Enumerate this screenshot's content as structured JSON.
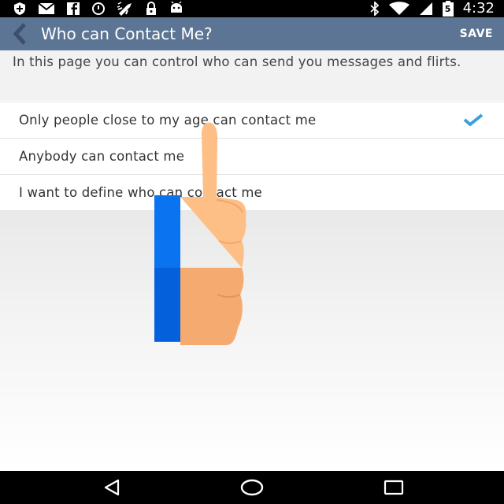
{
  "status_bar": {
    "time": "4:32",
    "icons_left": [
      "shield-icon",
      "mail-icon",
      "facebook-icon",
      "alarm-icon",
      "rocket-icon",
      "lock-icon",
      "android-icon"
    ],
    "icons_right": [
      "bluetooth-icon",
      "wifi-icon",
      "battery-icon"
    ],
    "battery_label": "5"
  },
  "action_bar": {
    "title": "Who can Contact Me?",
    "save_label": "SAVE",
    "background_color": "#5d7595"
  },
  "description": "In this page you can control who can send you messages and flirts.",
  "options": [
    {
      "label": "Only people close to my age can contact me",
      "selected": true
    },
    {
      "label": "Anybody can contact me",
      "selected": false
    },
    {
      "label": "I want to define who can contact me",
      "selected": false
    }
  ],
  "accent_color": "#3aa0dc",
  "overlay": {
    "type": "thumbs-up-hand-icon"
  },
  "nav_bar": {
    "buttons": [
      "back-triangle-icon",
      "home-circle-icon",
      "recents-square-icon"
    ]
  }
}
